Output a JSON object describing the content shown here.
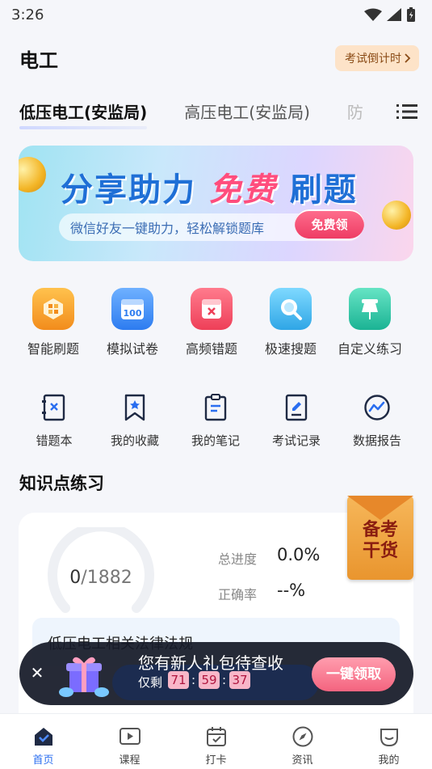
{
  "status_bar": {
    "time": "3:26"
  },
  "header": {
    "title": "电工",
    "countdown_label": "考试倒计时"
  },
  "tabs": [
    {
      "label": "低压电工(安监局)",
      "active": true
    },
    {
      "label": "高压电工(安监局)",
      "active": false
    },
    {
      "label": "防",
      "active": false
    }
  ],
  "banner": {
    "title_part1": "分享助力",
    "title_part2": "免费",
    "title_part3": "刷题",
    "subtitle": "微信好友一键助力，轻松解锁题库",
    "cta": "免费领"
  },
  "features": [
    {
      "label": "智能刷题",
      "icon": "smart-practice-icon",
      "color": "#f7a62b"
    },
    {
      "label": "模拟试卷",
      "icon": "mock-exam-icon",
      "color": "#3f8df2"
    },
    {
      "label": "高频错题",
      "icon": "frequent-mistakes-icon",
      "color": "#f2506a"
    },
    {
      "label": "极速搜题",
      "icon": "quick-search-icon",
      "color": "#39b4e8"
    },
    {
      "label": "自定义练习",
      "icon": "custom-practice-icon",
      "color": "#2ec4a8"
    }
  ],
  "tools": [
    {
      "label": "错题本",
      "icon": "mistake-book-icon"
    },
    {
      "label": "我的收藏",
      "icon": "bookmark-icon"
    },
    {
      "label": "我的笔记",
      "icon": "notes-icon"
    },
    {
      "label": "考试记录",
      "icon": "exam-record-icon"
    },
    {
      "label": "数据报告",
      "icon": "data-report-icon"
    }
  ],
  "knowledge": {
    "section_title": "知识点练习",
    "done": "0",
    "total": "/1882",
    "progress_label": "总进度",
    "progress_value": "0.0%",
    "accuracy_label": "正确率",
    "accuracy_value": "--%",
    "chapter_title": "低压电工相关法律法规"
  },
  "pouch": {
    "line1": "备考",
    "line2": "干货"
  },
  "promo": {
    "title": "您有新人礼包待查收",
    "remain_label": "仅剩",
    "hours": "71",
    "minutes": "59",
    "seconds": "37",
    "button": "一键领取",
    "close": "✕"
  },
  "bottom_nav": [
    {
      "label": "首页",
      "icon": "home-icon",
      "active": true
    },
    {
      "label": "课程",
      "icon": "course-icon",
      "active": false
    },
    {
      "label": "打卡",
      "icon": "checkin-icon",
      "active": false
    },
    {
      "label": "资讯",
      "icon": "news-compass-icon",
      "active": false
    },
    {
      "label": "我的",
      "icon": "profile-icon",
      "active": false
    }
  ],
  "colors": {
    "accent": "#2a6ef0",
    "promo_button": "#f4647f",
    "countdown_bg": "#fde3c8"
  }
}
